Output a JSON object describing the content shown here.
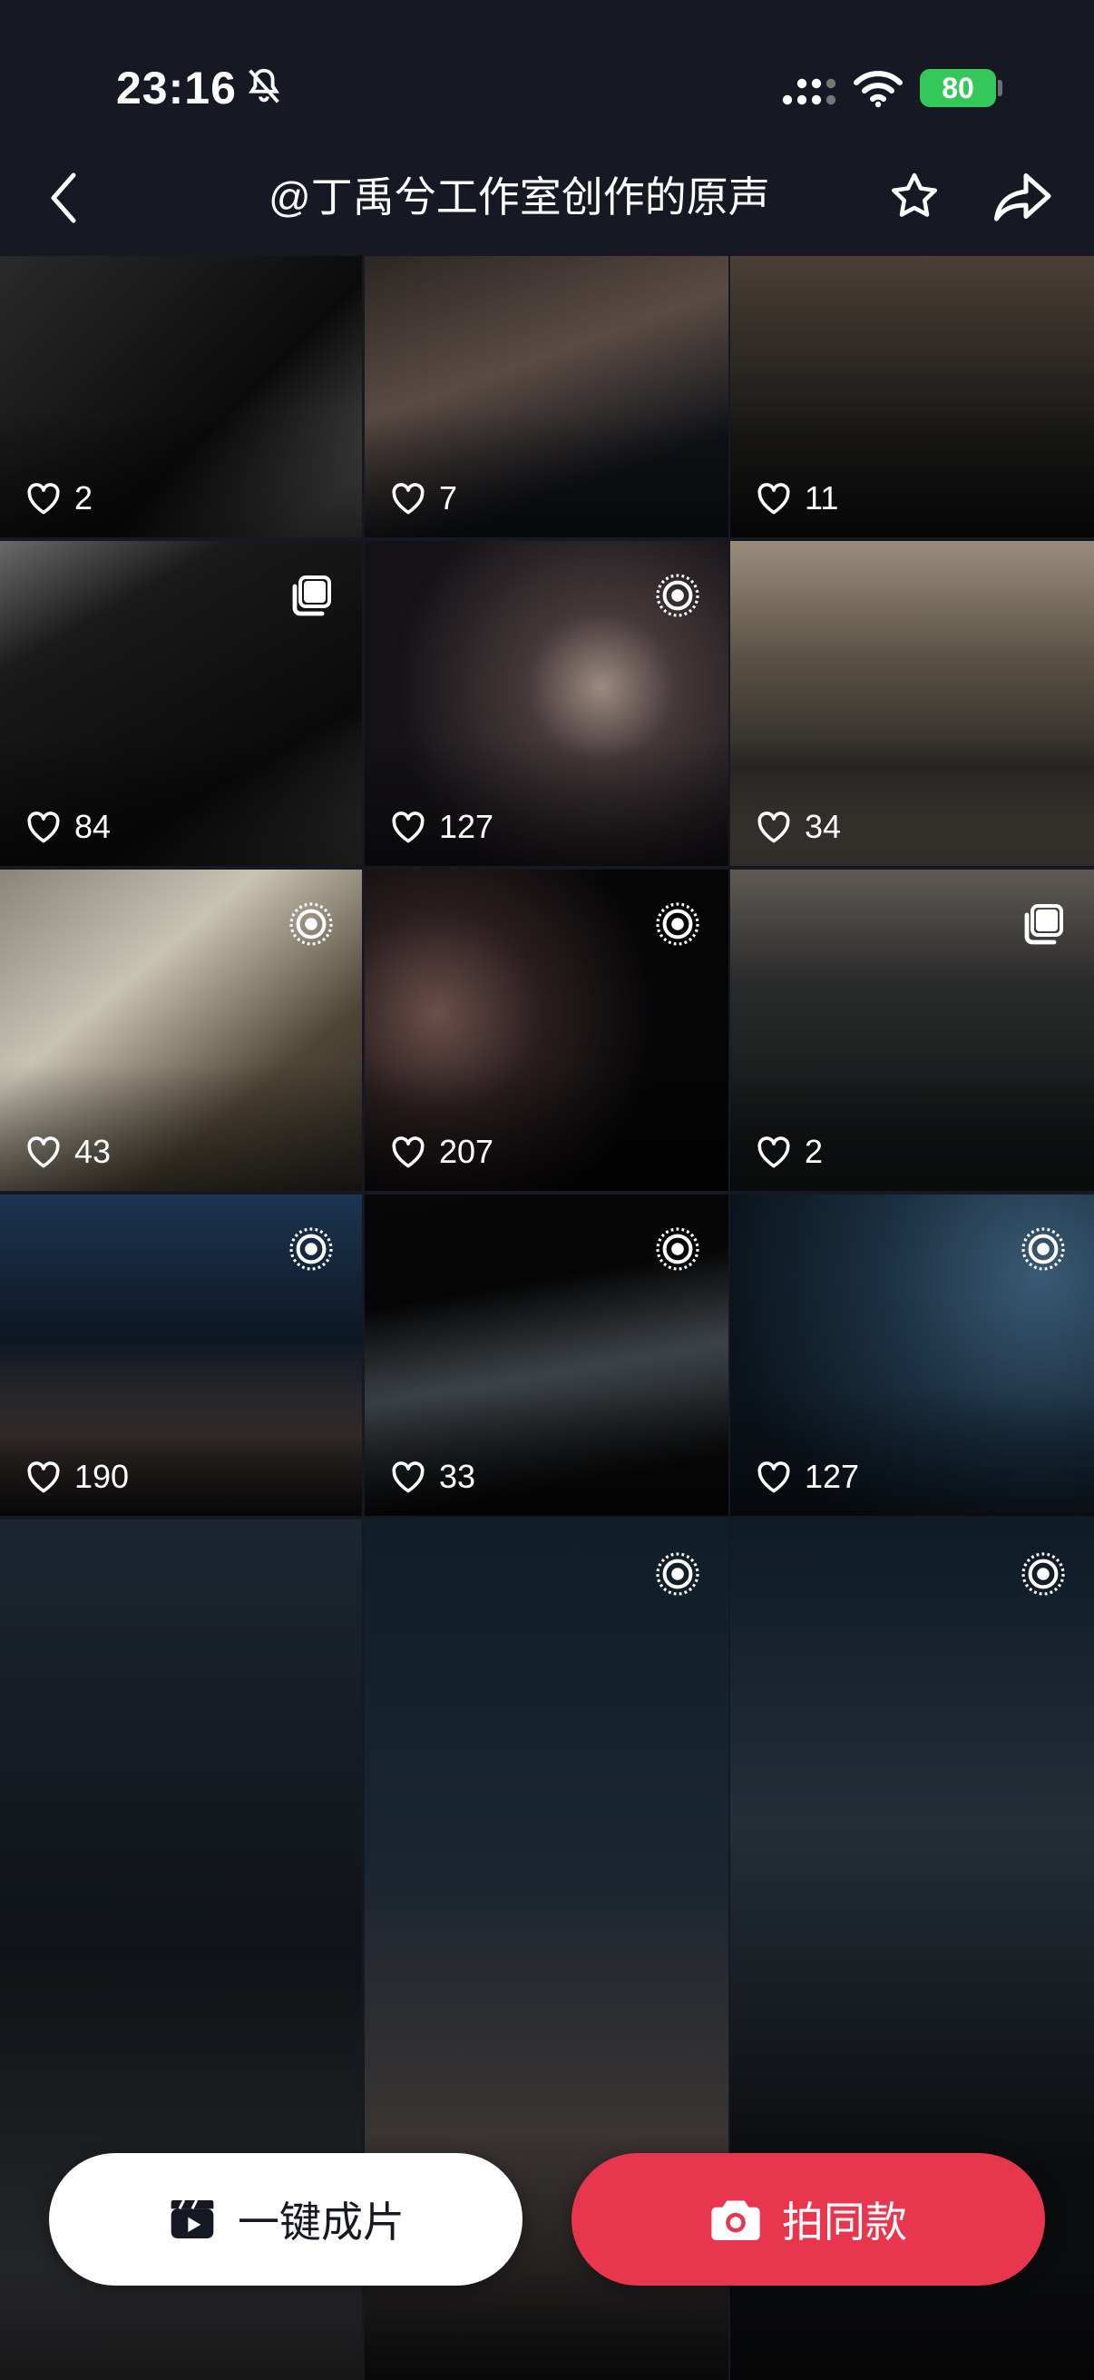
{
  "status_bar": {
    "time": "23:16",
    "battery": "80"
  },
  "nav": {
    "title": "@丁禹兮工作室创作的原声"
  },
  "videos": [
    {
      "likes": "2",
      "type": "none",
      "bg": "linear-gradient(135deg,#2a2a2a,#0b0b0b 60%,#444 90%)"
    },
    {
      "likes": "7",
      "type": "none",
      "bg": "linear-gradient(160deg,#2b2623 0%,#5a4b44 40%,#101318 75%)"
    },
    {
      "likes": "11",
      "type": "none",
      "bg": "linear-gradient(180deg,#4a4036 0%,#1b1a18 60%,#0e0e0e)"
    },
    {
      "likes": "84",
      "type": "carousel",
      "bg": "linear-gradient(150deg,#6a6a6a 0%,#1a1a1a 25%,#0a0a0a 70%,#3a3a3a)"
    },
    {
      "likes": "127",
      "type": "live",
      "bg": "radial-gradient(circle at 65% 45%,#9c8a80 0%,#45393a 25%,#141216 70%)"
    },
    {
      "likes": "34",
      "type": "none",
      "bg": "linear-gradient(180deg,#9a8d7c 0%,#5c5346 35%,#2c2a26 70%,#6a6158)"
    },
    {
      "likes": "43",
      "type": "live",
      "bg": "linear-gradient(140deg,#8a8577 0%,#c9c3b4 35%,#4f4536 70%,#2d2a24)"
    },
    {
      "likes": "207",
      "type": "live",
      "bg": "radial-gradient(circle at 20% 45%,#6b4f4a 0%,#2a1e1f 30%,#050506 65%)"
    },
    {
      "likes": "2",
      "type": "carousel",
      "bg": "linear-gradient(180deg,#5f5a54 0%,#2a2b2b 35%,#151718 80%)"
    },
    {
      "likes": "190",
      "type": "live",
      "bg": "linear-gradient(180deg,#1c3550 0%,#0d1724 45%,#3b3230 75%,#121212)"
    },
    {
      "likes": "33",
      "type": "live",
      "bg": "linear-gradient(170deg,#070707 0%,#050505 30%,#3c4348 55%,#080808 85%)"
    },
    {
      "likes": "127",
      "type": "live",
      "bg": "radial-gradient(circle at 85% 25%,#3a5a73 0%,#1b3042 40%,#0b141c 80%)"
    },
    {
      "likes": "",
      "type": "none",
      "bg": "linear-gradient(180deg,#1c2530 0%,#0f1317 50%,#2d2d2f)"
    },
    {
      "likes": "",
      "type": "live",
      "bg": "linear-gradient(180deg,#101e28 0%,#1a2530 40%,#3a3432 70%,#111)"
    },
    {
      "likes": "",
      "type": "live",
      "bg": "linear-gradient(180deg,#0e1a26 0%,#232e37 35%,#0b0c0e 75%)"
    }
  ],
  "bottom_actions": {
    "one_click_label": "一键成片",
    "shoot_same_label": "拍同款"
  },
  "colors": {
    "background": "#161823",
    "accent": "#e8364f",
    "battery": "#34c759"
  }
}
